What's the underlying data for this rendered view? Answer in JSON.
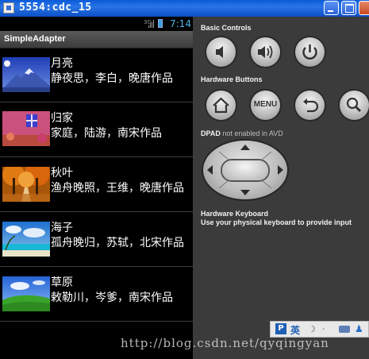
{
  "window": {
    "title": "5554:cdc_15"
  },
  "statusbar": {
    "signal_label": "3G",
    "time": "7:14"
  },
  "app": {
    "title": "SimpleAdapter"
  },
  "list": [
    {
      "title": "月亮",
      "subtitle": "静夜思，李白，晚唐作品",
      "image": "moon-mountain-landscape"
    },
    {
      "title": "归家",
      "subtitle": "家庭，陆游，南宋作品",
      "image": "pink-house-window"
    },
    {
      "title": "秋叶",
      "subtitle": "渔舟晚照，王维，晚唐作品",
      "image": "autumn-tree-path"
    },
    {
      "title": "海子",
      "subtitle": "孤舟晚归，苏轼，北宋作品",
      "image": "tropical-beach-sky"
    },
    {
      "title": "草原",
      "subtitle": "敕勒川，岑爹，南宋作品",
      "image": "green-hill-blue-sky"
    }
  ],
  "panel": {
    "basic_controls": "Basic Controls",
    "hardware_buttons": "Hardware Buttons",
    "menu_label": "MENU",
    "dpad_label": "DPAD",
    "dpad_note": "not enabled in AVD",
    "keyboard_title": "Hardware Keyboard",
    "keyboard_note": "Use your physical keyboard to provide input"
  },
  "ime": {
    "logo": "P",
    "lang": "英"
  },
  "watermark": "http://blog.csdn.net/qyqingyan",
  "colors": {
    "titlebar": "#0a5bd8",
    "time": "#4fb3ea",
    "panel_bg": "#3b3b3b"
  }
}
